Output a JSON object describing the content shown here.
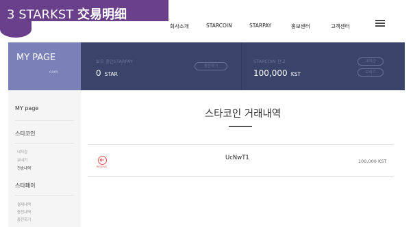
{
  "banner": {
    "number": "3",
    "title_latin": "STARKST",
    "title_cjk": "交易明细"
  },
  "nav": {
    "items": [
      "회사소개",
      "STARCOIN",
      "STARPAY",
      "홍보센터",
      "고객센터"
    ],
    "menu_icon": "hamburger-icon"
  },
  "header": {
    "mypage_title": "MY PAGE",
    "mypage_sub": "com",
    "star_label": "보유 중인STARPAY",
    "star_value": "0",
    "star_unit": "STAR",
    "charge_button": "충전하기",
    "coin_label": "STARCOIN 잔고",
    "coin_value": "100,000",
    "coin_unit": "KST",
    "receive_button": "내지갑",
    "send_button": "보내기"
  },
  "sidebar": {
    "title": "MY page",
    "section1": "스타코인",
    "section1_items": [
      "내지갑",
      "보내기",
      "전송내역"
    ],
    "section2": "스타페이",
    "section2_items": [
      "결제내역",
      "충전내역",
      "충전하기"
    ]
  },
  "main": {
    "title": "스타코인 거래내역",
    "record": {
      "icon": "receive-icon",
      "type_label": "RECEIVE",
      "id": "UcNwT1",
      "amount": "100,000 KST"
    }
  },
  "colors": {
    "banner": "#6a3f8c",
    "band": "#3a4369",
    "mypage_box": "#7a80b8",
    "sidebar": "#f5f5f6",
    "record_accent": "#e05050"
  }
}
